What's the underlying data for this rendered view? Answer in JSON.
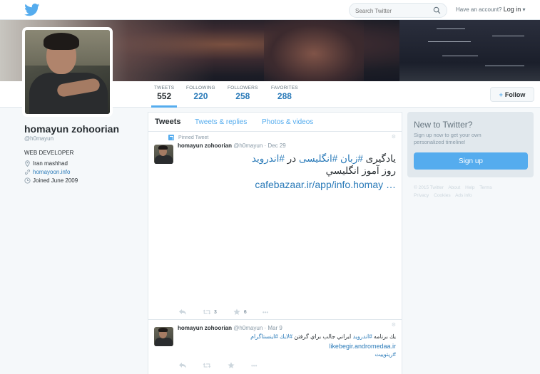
{
  "topbar": {
    "logo_icon": "twitter-bird-icon",
    "search_placeholder": "Search Twitter",
    "account_prompt": "Have an account?",
    "login_label": "Log in",
    "login_caret": "▾"
  },
  "profile_nav": {
    "stats": [
      {
        "label": "TWEETS",
        "value": "552"
      },
      {
        "label": "FOLLOWING",
        "value": "220"
      },
      {
        "label": "FOLLOWERS",
        "value": "258"
      },
      {
        "label": "FAVORITES",
        "value": "288"
      }
    ],
    "follow_label": "Follow",
    "follow_plus": "+"
  },
  "profile": {
    "name": "homayun zohoorian",
    "handle": "@h0mayun",
    "bio": "WEB DEVELOPER",
    "location": "Iran mashhad",
    "website": "homayoon.info",
    "joined": "Joined June 2009"
  },
  "timeline": {
    "tabs": [
      "Tweets",
      "Tweets & replies",
      "Photos & videos"
    ],
    "pinned_label": "Pinned Tweet",
    "tweets": [
      {
        "author": "homayun zohoorian",
        "handle_date": "@h0mayun · Dec 29",
        "text_parts": [
          "یادگیری ",
          "#زبان",
          " ",
          "#انگلیسی",
          " در ",
          "#اندروید"
        ],
        "text_line2": "روز آموز انگليسي",
        "link": "cafebazaar.ir/app/info.homay …",
        "retweets": "3",
        "favorites": "6",
        "more": "•••"
      },
      {
        "author": "homayun zohoorian",
        "handle_date": "@h0mayun · Mar 9",
        "text_parts": [
          "يك برنامه ",
          "#اندروید",
          " ايراني جالب براي گرفتن ",
          "#لايك",
          " ",
          "#اينستاگرام"
        ],
        "link": "likebegir.andromedaa.ir",
        "hashtag_line": "#ريتوييت",
        "more": "•••"
      }
    ]
  },
  "sidebar": {
    "title": "New to Twitter?",
    "text": "Sign up now to get your own personalized timeline!",
    "button": "Sign up",
    "footer_line1": [
      "© 2015 Twitter",
      "About",
      "Help",
      "Terms"
    ],
    "footer_line2": [
      "Privacy",
      "Cookies",
      "Ads info"
    ]
  },
  "colors": {
    "accent": "#55acee",
    "link": "#2b7bb9",
    "text": "#292f33",
    "muted": "#8899a6"
  }
}
